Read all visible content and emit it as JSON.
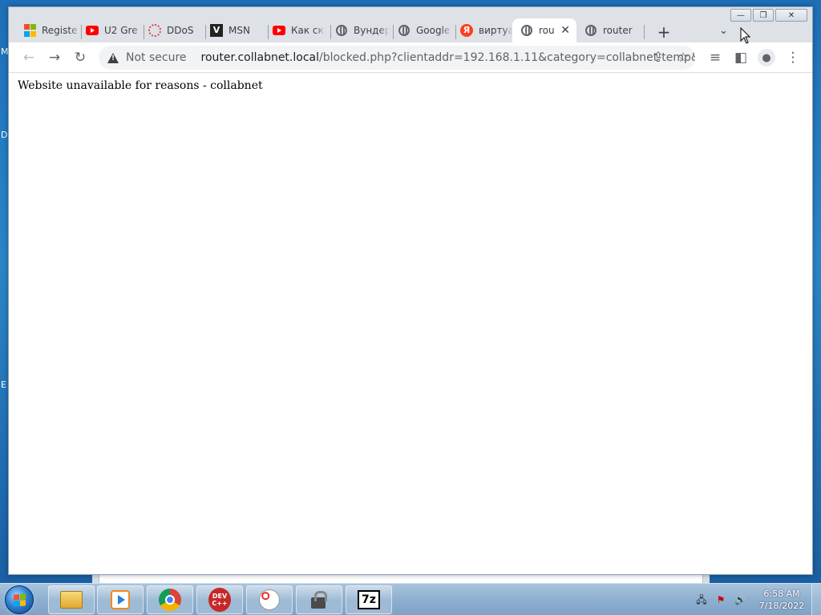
{
  "desktop": {
    "peek_letters": [
      "M",
      "D",
      "E"
    ]
  },
  "window_controls": {
    "minimize": "—",
    "maximize": "❐",
    "close": "✕"
  },
  "tabs": [
    {
      "title": "Registe",
      "icon": "microsoft-icon",
      "active": false
    },
    {
      "title": "U2 Gre",
      "icon": "youtube-icon",
      "active": false
    },
    {
      "title": "DDoS",
      "icon": "ddos-icon",
      "active": false
    },
    {
      "title": "MSN",
      "icon": "msn-icon",
      "active": false
    },
    {
      "title": "Как ск",
      "icon": "youtube-icon",
      "active": false
    },
    {
      "title": "Вундер",
      "icon": "globe-icon",
      "active": false
    },
    {
      "title": "Google",
      "icon": "globe-icon",
      "active": false
    },
    {
      "title": "виртуа",
      "icon": "yandex-icon",
      "active": false
    },
    {
      "title": "rou",
      "icon": "globe-icon",
      "active": true
    },
    {
      "title": "router",
      "icon": "globe-icon",
      "active": false
    }
  ],
  "toolbar": {
    "security_label": "Not secure",
    "url_host": "router.collabnet.local",
    "url_path": "/blocked.php?clientaddr=192.168.1.11&category=collabnet-temp&..."
  },
  "page": {
    "message": "Website unavailable for reasons - collabnet"
  },
  "taskbar": {
    "apps": [
      "windows-explorer",
      "media-player",
      "google-chrome",
      "dev-cpp",
      "paint",
      "network-lock",
      "7-zip"
    ],
    "dev_icon_text": "DEV C++",
    "sevenzip_icon_text": "7z",
    "clock_time": "6:58 AM",
    "clock_date": "7/18/2022"
  },
  "colors": {
    "chrome_frame": "#dee1e6",
    "omnibox_bg": "#f1f3f4",
    "taskbar": "#8eb0d0",
    "desktop": "#1d6fb8"
  }
}
